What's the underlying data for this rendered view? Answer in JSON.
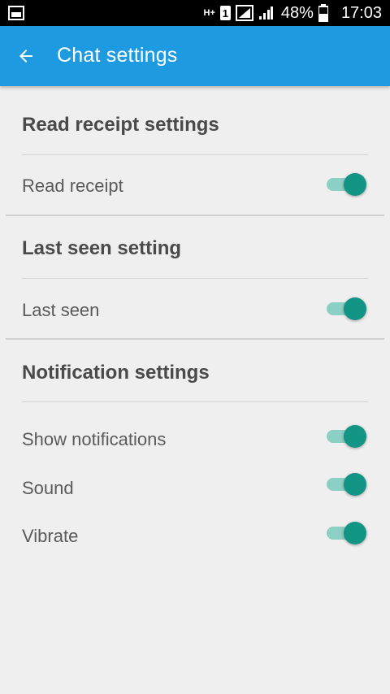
{
  "status_bar": {
    "battery_percent": "48%",
    "time": "17:03",
    "network_label": "H+",
    "sim_label": "1"
  },
  "app_bar": {
    "title": "Chat settings",
    "back_icon": "arrow-left-icon",
    "color": "#1e9be0"
  },
  "sections": [
    {
      "header": "Read receipt settings",
      "rows": [
        {
          "label": "Read receipt",
          "enabled": true
        }
      ]
    },
    {
      "header": "Last seen setting",
      "rows": [
        {
          "label": "Last seen",
          "enabled": true
        }
      ]
    },
    {
      "header": "Notification settings",
      "rows": [
        {
          "label": "Show notifications",
          "enabled": true
        },
        {
          "label": "Sound",
          "enabled": true
        },
        {
          "label": "Vibrate",
          "enabled": true
        }
      ]
    }
  ],
  "colors": {
    "toggle_thumb": "#129585",
    "toggle_track": "#8ccfc4",
    "background": "#efefef"
  }
}
